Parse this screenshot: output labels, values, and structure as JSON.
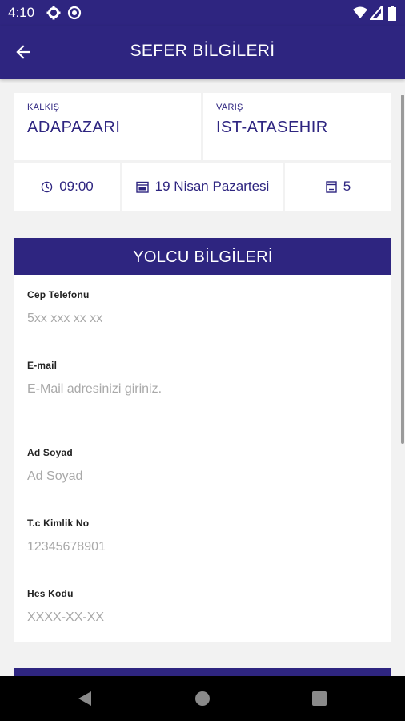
{
  "status_bar": {
    "time": "4:10"
  },
  "app_bar": {
    "title": "SEFER BİLGİLERİ"
  },
  "route": {
    "departure_label": "KALKIŞ",
    "departure_city": "ADAPAZARI",
    "arrival_label": "VARIŞ",
    "arrival_city": "IST-ATASEHIR"
  },
  "trip_info": {
    "time": "09:00",
    "date": "19 Nisan Pazartesi",
    "seat": "5"
  },
  "passenger": {
    "section_title": "YOLCU BİLGİLERİ",
    "fields": [
      {
        "label": "Cep Telefonu",
        "placeholder": "5xx xxx xx xx",
        "value": ""
      },
      {
        "label": "E-mail",
        "placeholder": "E-Mail adresinizi giriniz.",
        "value": ""
      },
      {
        "label": "Ad Soyad",
        "placeholder": "Ad Soyad",
        "value": ""
      },
      {
        "label": "T.c Kimlik No",
        "placeholder": "12345678901",
        "value": ""
      },
      {
        "label": "Hes Kodu",
        "placeholder": "XXXX-XX-XX",
        "value": ""
      }
    ]
  },
  "colors": {
    "primary": "#2e2580",
    "background": "#f2f2f2",
    "placeholder": "#a9a9a9"
  },
  "icons": [
    "back-arrow-icon",
    "clock-icon",
    "calendar-icon",
    "seat-icon"
  ]
}
